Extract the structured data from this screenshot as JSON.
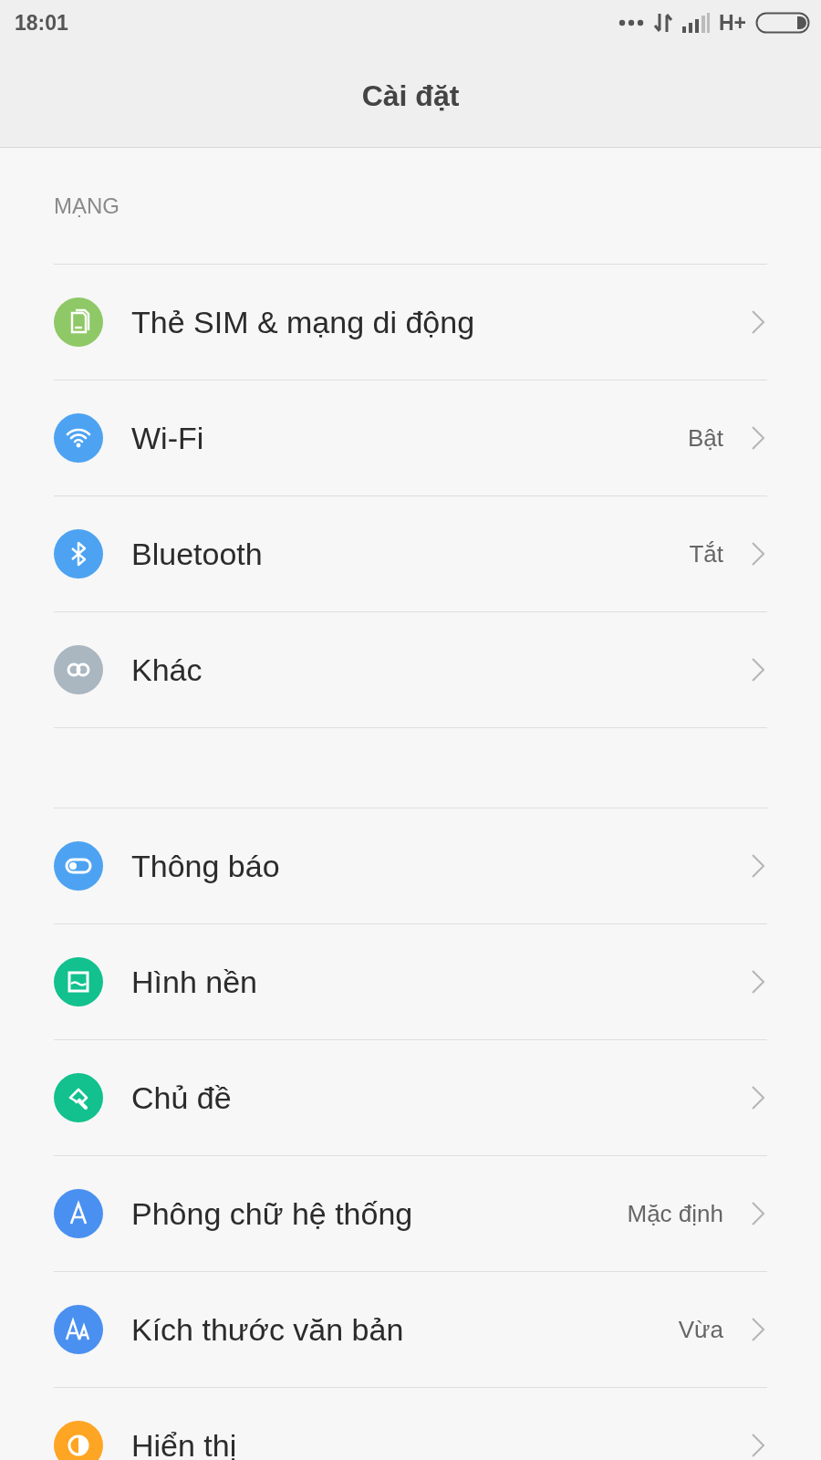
{
  "status_bar": {
    "time": "18:01",
    "network": "H+"
  },
  "header": {
    "title": "Cài đặt"
  },
  "sections": [
    {
      "label": "MẠNG",
      "items": [
        {
          "kind": "sim",
          "color": "#8fc866",
          "label": "Thẻ SIM & mạng di động"
        },
        {
          "kind": "wifi",
          "color": "#4da3f1",
          "label": "Wi-Fi",
          "value": "Bật"
        },
        {
          "kind": "bluetooth",
          "color": "#4da3f1",
          "label": "Bluetooth",
          "value": "Tắt"
        },
        {
          "kind": "link",
          "color": "#aab6c0",
          "label": "Khác"
        }
      ]
    },
    {
      "items": [
        {
          "kind": "toggle",
          "color": "#4da3f1",
          "label": "Thông báo"
        },
        {
          "kind": "wallpaper",
          "color": "#12c18d",
          "label": "Hình nền"
        },
        {
          "kind": "brush",
          "color": "#12c18d",
          "label": "Chủ đề"
        },
        {
          "kind": "font",
          "color": "#4a90f0",
          "label": "Phông chữ hệ thống",
          "value": "Mặc định"
        },
        {
          "kind": "text-size",
          "color": "#4a90f0",
          "label": "Kích thước văn bản",
          "value": "Vừa"
        },
        {
          "kind": "display",
          "color": "#ffa524",
          "label": "Hiển thị"
        }
      ]
    }
  ]
}
